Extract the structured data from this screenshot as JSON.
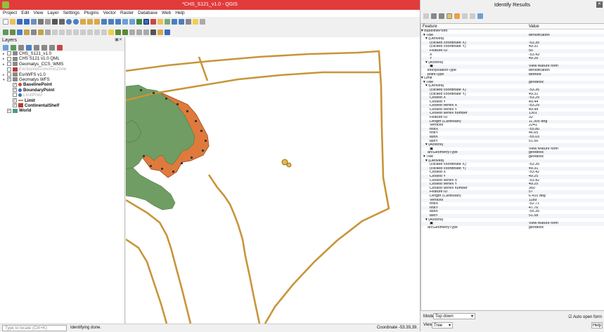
{
  "window": {
    "title": "*CHS_S121_v1.0 - QGIS"
  },
  "menu": [
    "Project",
    "Edit",
    "View",
    "Layer",
    "Settings",
    "Plugins",
    "Vector",
    "Raster",
    "Database",
    "Web",
    "Help"
  ],
  "layers_panel": {
    "title": "Layers"
  },
  "layers": [
    {
      "label": "CHS_S121_v1.0",
      "depth": 0,
      "checked": false,
      "expand": "▸",
      "icon": "wms-icon",
      "style": "normal"
    },
    {
      "label": "CHS S121 v1.0 QML",
      "depth": 0,
      "checked": false,
      "expand": "▸",
      "icon": "wms-icon",
      "style": "normal"
    },
    {
      "label": "Geomatys_CCS_WMS",
      "depth": 0,
      "checked": false,
      "expand": "▸",
      "icon": "wms-icon",
      "style": "normal"
    },
    {
      "label": "ExclusiveEconomicZone",
      "depth": 0,
      "checked": false,
      "expand": "",
      "icon": "polygon-red-icon",
      "style": "disabled"
    },
    {
      "label": "EsriWFS v1.0",
      "depth": 0,
      "checked": false,
      "expand": "▸",
      "icon": "wms-icon",
      "style": "normal"
    },
    {
      "label": "Geomatys WFS",
      "depth": 0,
      "checked": true,
      "expand": "▾",
      "icon": "wms-icon",
      "style": "normal"
    },
    {
      "label": "BaselinePoint",
      "depth": 1,
      "checked": true,
      "expand": "",
      "icon": "point-red-icon",
      "style": "bold"
    },
    {
      "label": "BoundaryPoint",
      "depth": 1,
      "checked": true,
      "expand": "",
      "icon": "point-blue-icon",
      "style": "bold"
    },
    {
      "label": "LimitPoint",
      "depth": 1,
      "checked": false,
      "expand": "",
      "icon": "point-blue-icon",
      "style": "disabled"
    },
    {
      "label": "Limit",
      "depth": 1,
      "checked": true,
      "expand": "",
      "icon": "line-icon",
      "style": "bold"
    },
    {
      "label": "ContinentalShelf",
      "depth": 1,
      "checked": true,
      "expand": "",
      "icon": "polygon-red-icon",
      "style": "bold"
    },
    {
      "label": "World",
      "depth": 0,
      "checked": true,
      "expand": "",
      "icon": "polygon-teal-icon",
      "style": "bold"
    }
  ],
  "status": {
    "locator_placeholder": "Type to locate (Ctrl+K)",
    "message": "Identifying done.",
    "coordinate": "Coordinate  -53.39,39."
  },
  "identify": {
    "title": "Identify Results",
    "col_feature": "Feature",
    "col_value": "Value",
    "rows": [
      [
        "▾ BaselinePoint",
        ""
      ],
      [
        "  ▾ Title",
        "densification"
      ],
      [
        "    ▾ (Derived)",
        ""
      ],
      [
        "        (clicked coordinate X)",
        "-53.35"
      ],
      [
        "        (clicked coordinate Y)",
        "49.31"
      ],
      [
        "        Feature ID",
        "50"
      ],
      [
        "        X",
        "-53.43"
      ],
      [
        "        Y",
        "49.26"
      ],
      [
        "    ▾ (Actions)",
        ""
      ],
      [
        "        ▣",
        "View feature form"
      ],
      [
        "      interpolationType",
        "densification"
      ],
      [
        "      pointType",
        "defined"
      ],
      [
        "▾ Limit",
        ""
      ],
      [
        "  ▾ Title",
        "geodesic"
      ],
      [
        "    ▾ (Derived)",
        ""
      ],
      [
        "        (clicked coordinate X)",
        "-53.35"
      ],
      [
        "        (clicked coordinate Y)",
        "49.31"
      ],
      [
        "        Closest X",
        "-53.29"
      ],
      [
        "        Closest Y",
        "49.44"
      ],
      [
        "        Closest vertex X",
        "-53.29"
      ],
      [
        "        Closest vertex Y",
        "49.44"
      ],
      [
        "        Closest vertex number",
        "1301"
      ],
      [
        "        Feature ID",
        "32"
      ],
      [
        "        Length (Cartesian)",
        "11.305 deg"
      ],
      [
        "        Vertices",
        "2241"
      ],
      [
        "        firstX",
        "-55.80"
      ],
      [
        "        firstY",
        "46.65"
      ],
      [
        "        lastX",
        "-55.03"
      ],
      [
        "        lastY",
        "51.56"
      ],
      [
        "    ▾ (Actions)",
        ""
      ],
      [
        "        ▣",
        "View feature form"
      ],
      [
        "      arcGeometryType",
        "geodesic"
      ],
      [
        "  ▾ Title",
        "geodesic"
      ],
      [
        "    ▾ (Derived)",
        ""
      ],
      [
        "        (clicked coordinate X)",
        "-53.35"
      ],
      [
        "        (clicked coordinate Y)",
        "49.31"
      ],
      [
        "        Closest X",
        "-53.42"
      ],
      [
        "        Closest Y",
        "49.25"
      ],
      [
        "        Closest vertex X",
        "-53.42"
      ],
      [
        "        Closest vertex Y",
        "49.25"
      ],
      [
        "        Closest vertex number",
        "360"
      ],
      [
        "        Feature ID",
        "57"
      ],
      [
        "        Length (Cartesian)",
        "6.410 deg"
      ],
      [
        "        Vertices",
        "1189"
      ],
      [
        "        firstX",
        "-52.71"
      ],
      [
        "        firstY",
        "47.76"
      ],
      [
        "        lastX",
        "-55.35"
      ],
      [
        "        lastY",
        "51.58"
      ],
      [
        "    ▾ (Actions)",
        ""
      ],
      [
        "        ▣",
        "View feature form"
      ],
      [
        "      arcGeometryType",
        "geodesic"
      ]
    ],
    "mode_label": "Mode",
    "mode_value": "Top down",
    "auto_open_label": "Auto open form",
    "view_label": "View",
    "view_value": "Tree",
    "help_label": "Help"
  },
  "colors": {
    "land": "#6f9d63",
    "shelf": "#e07a3c",
    "limit": "#c8953a",
    "title_bg": "#e23b3b"
  }
}
